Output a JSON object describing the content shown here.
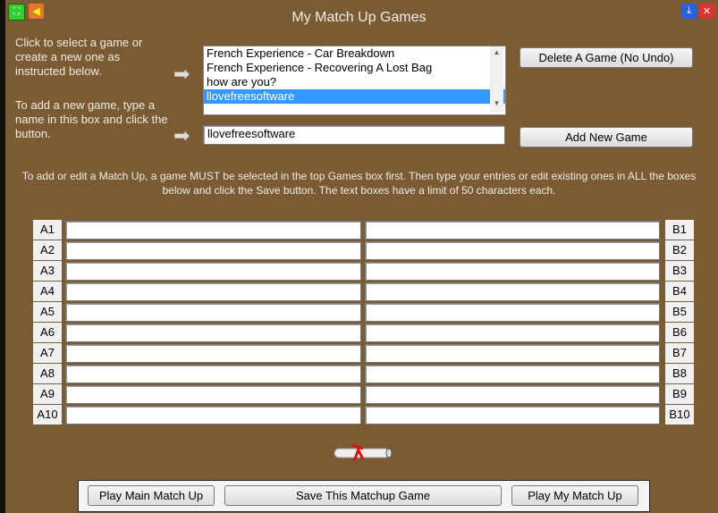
{
  "window": {
    "title": "My Match Up Games"
  },
  "instructions": {
    "select": "Click to select a game or create a new one as instructed below.",
    "add": "To add a new game, type a name in this box and click the button.",
    "edit": "To add or edit a Match Up, a game MUST be selected in the top Games box first. Then type your entries or edit existing ones in ALL the boxes below and click the Save button. The text boxes have a limit of 50 characters each."
  },
  "games": [
    "French Experience - Car Breakdown",
    "French Experience - Recovering A Lost Bag",
    "how are you?",
    "llovefreesoftware"
  ],
  "selected_game": "llovefreesoftware",
  "new_game_input": "llovefreesoftware",
  "buttons": {
    "delete": "Delete A Game (No Undo)",
    "add": "Add New Game",
    "play_main": "Play Main Match Up",
    "save": "Save This Matchup Game",
    "play_my": "Play My Match Up"
  },
  "rows": [
    {
      "a": "A1",
      "b": "B1"
    },
    {
      "a": "A2",
      "b": "B2"
    },
    {
      "a": "A3",
      "b": "B3"
    },
    {
      "a": "A4",
      "b": "B4"
    },
    {
      "a": "A5",
      "b": "B5"
    },
    {
      "a": "A6",
      "b": "B6"
    },
    {
      "a": "A7",
      "b": "B7"
    },
    {
      "a": "A8",
      "b": "B8"
    },
    {
      "a": "A9",
      "b": "B9"
    },
    {
      "a": "A10",
      "b": "B10"
    }
  ]
}
